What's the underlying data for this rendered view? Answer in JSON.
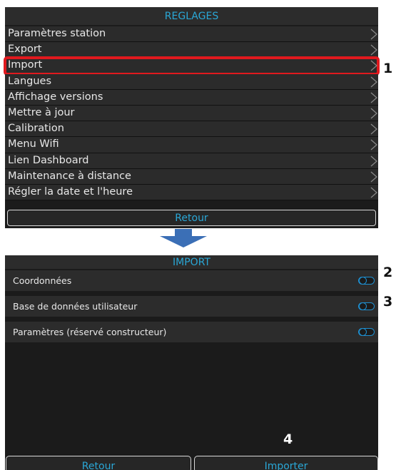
{
  "settings": {
    "title": "REGLAGES",
    "items": [
      {
        "label": "Paramètres station"
      },
      {
        "label": "Export"
      },
      {
        "label": "Import"
      },
      {
        "label": "Langues"
      },
      {
        "label": "Affichage versions"
      },
      {
        "label": "Mettre à jour"
      },
      {
        "label": "Calibration"
      },
      {
        "label": "Menu Wifi"
      },
      {
        "label": "Lien Dashboard"
      },
      {
        "label": "Maintenance à distance"
      },
      {
        "label": "Régler la date et l'heure"
      }
    ],
    "retour_label": "Retour"
  },
  "import": {
    "title": "IMPORT",
    "rows": [
      {
        "label": "Coordonnées",
        "enabled": false
      },
      {
        "label": "Base de données utilisateur",
        "enabled": false
      },
      {
        "label": "Paramètres (réservé constructeur)",
        "enabled": false
      }
    ],
    "retour_label": "Retour",
    "importer_label": "Importer"
  },
  "callouts": [
    "1",
    "2",
    "3",
    "4"
  ],
  "colors": {
    "accent": "#2aa7d6",
    "highlight": "#e0191e",
    "arrow": "#3b6fb6",
    "toggle": "#1e8fd0"
  },
  "icons": {
    "menu_chevron": "chevron-right-icon",
    "arrow": "arrow-down-icon",
    "toggle": "toggle-switch-icon"
  }
}
